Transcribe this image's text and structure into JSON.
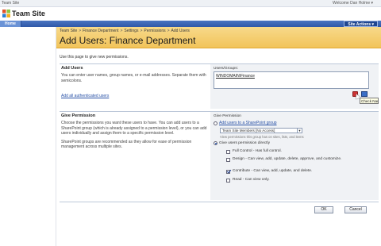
{
  "topbar": {
    "site": "Team Site",
    "user": "Welcome Dan Holme ▾"
  },
  "header": {
    "title": "Team Site"
  },
  "nav": {
    "home_tab": "Home",
    "site_actions": "Site Actions ▾"
  },
  "breadcrumb": [
    "Team Site",
    "Finance Department",
    "Settings",
    "Permissions",
    "Add Users"
  ],
  "page": {
    "title": "Add Users: Finance Department",
    "intro": "Use this page to give new permissions."
  },
  "add_users": {
    "heading": "Add Users",
    "desc": "You can enter user names, group names, or e-mail addresses. Separate them with semicolons.",
    "link": "Add all authenticated users",
    "field_label": "Users/Groups:",
    "value": "WINDOMAIN\\Finance",
    "tooltip": "Check Names"
  },
  "give_permission": {
    "heading": "Give Permission",
    "desc1": "Choose the permissions you want these users to have. You can add users to a SharePoint group (which is already assigned to a permission level), or you can add users individually and assign them to a specific permission level.",
    "desc2": "SharePoint groups are recommended as they allow for ease of permission management across multiple sites.",
    "right_label": "Give Permission",
    "opt_group": "Add users to a SharePoint group",
    "select_value": "Team Site Members [No Access]",
    "hint": "View permissions this group has on sites, lists, and items",
    "opt_direct": "Give users permission directly",
    "perms": [
      {
        "label": "Full Control - Has full control.",
        "checked": false
      },
      {
        "label": "Design - Can view, add, update, delete, approve, and customize.",
        "checked": false
      },
      {
        "label": "Contribute - Can view, add, update, and delete.",
        "checked": true
      },
      {
        "label": "Read - Can view only.",
        "checked": false
      }
    ]
  },
  "buttons": {
    "ok": "OK",
    "cancel": "Cancel"
  }
}
